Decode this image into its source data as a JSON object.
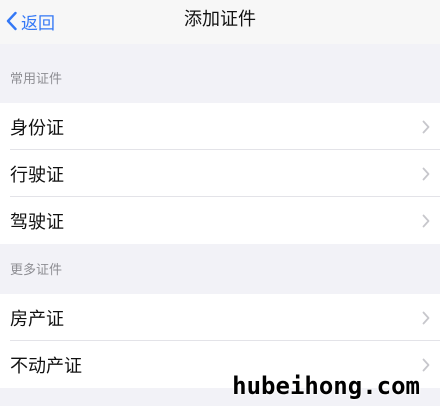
{
  "nav": {
    "back_label": "返回",
    "title": "添加证件"
  },
  "sections": [
    {
      "header": "常用证件",
      "items": [
        "身份证",
        "行驶证",
        "驾驶证"
      ]
    },
    {
      "header": "更多证件",
      "items": [
        "房产证",
        "不动产证"
      ]
    }
  ],
  "watermark": "hubeihong.com",
  "colors": {
    "accent": "#3478f6",
    "background": "#f2f2f7",
    "chevron": "#c7c7cc"
  }
}
